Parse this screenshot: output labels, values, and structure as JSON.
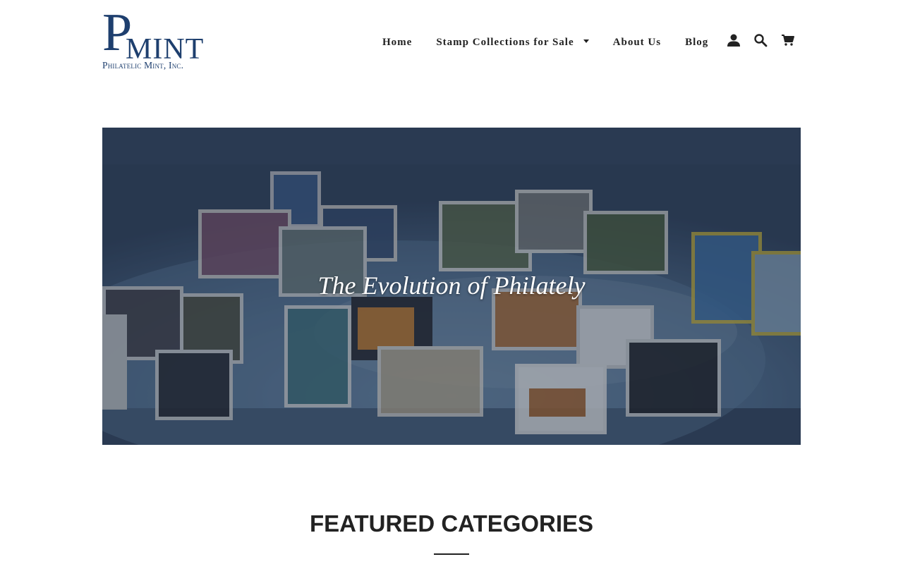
{
  "brand": {
    "logo_letter": "P",
    "logo_word": "MINT",
    "logo_subtitle": "Philatelic Mint, Inc."
  },
  "nav": {
    "items": [
      {
        "label": "Home"
      },
      {
        "label": "Stamp Collections for Sale",
        "has_dropdown": true
      },
      {
        "label": "About Us"
      },
      {
        "label": "Blog"
      }
    ],
    "icons": [
      "account-icon",
      "search-icon",
      "cart-icon"
    ]
  },
  "hero": {
    "title": "The Evolution of Philately"
  },
  "featured": {
    "title": "FEATURED CATEGORIES"
  },
  "colors": {
    "brand": "#1e3f6e",
    "text": "#222222",
    "hero_overlay": "#31435e"
  }
}
